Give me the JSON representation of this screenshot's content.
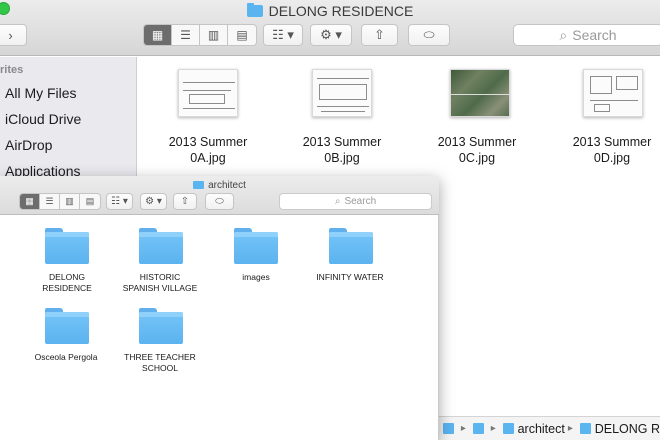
{
  "back_window": {
    "title": "DELONG RESIDENCE",
    "nav_forward": "›",
    "view_buttons": [
      "▦",
      "☰",
      "▥",
      "▤"
    ],
    "arrange_icon": "☷ ▾",
    "action_icon": "⚙ ▾",
    "share_icon": "⇧",
    "tag_icon": "⬭",
    "search": {
      "placeholder": "Search",
      "icon": "⌕"
    },
    "sidebar": {
      "heading": "rites",
      "items": [
        {
          "label": "All My Files"
        },
        {
          "label": "iCloud Drive"
        },
        {
          "label": "AirDrop"
        },
        {
          "label": "Applications"
        }
      ]
    },
    "files": [
      {
        "name_line1": "2013 Summer",
        "name_line2": "0A.jpg"
      },
      {
        "name_line1": "2013 Summer",
        "name_line2": "0B.jpg"
      },
      {
        "name_line1": "2013 Summer",
        "name_line2": "0C.jpg"
      },
      {
        "name_line1": "2013 Summer",
        "name_line2": "0D.jpg"
      }
    ],
    "pathbar": {
      "item_architect": "architect",
      "item_current": "DELONG R",
      "separator": "▸"
    }
  },
  "front_window": {
    "title": "architect",
    "view_buttons": [
      "▦",
      "☰",
      "▥",
      "▤"
    ],
    "arrange_icon": "☷ ▾",
    "action_icon": "⚙ ▾",
    "share_icon": "⇧",
    "tag_icon": "⬭",
    "search": {
      "placeholder": "Search",
      "icon": "⌕"
    },
    "folders": [
      {
        "line1": "DELONG",
        "line2": "RESIDENCE"
      },
      {
        "line1": "HISTORIC",
        "line2": "SPANISH VILLAGE"
      },
      {
        "line1": "images",
        "line2": ""
      },
      {
        "line1": "INFINITY WATER",
        "line2": ""
      },
      {
        "line1": "Osceola Pergola",
        "line2": ""
      },
      {
        "line1": "THREE TEACHER",
        "line2": "SCHOOL"
      }
    ]
  },
  "colors": {
    "folder_blue": "#5cb3ef",
    "active_segment": "#6d6d6d"
  }
}
